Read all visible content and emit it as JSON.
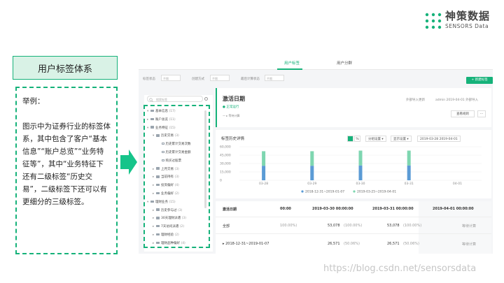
{
  "brand": {
    "name_cn": "神策数据",
    "name_en": "SENSORS Data",
    "accent": "#16b27a"
  },
  "left": {
    "title": "用户标签体系",
    "example_label": "举例：",
    "description": "图示中为证券行业的标签体系，其中包含了客户“基本信息”“账户总览”“业务特征等”，其中“业务特征下还有二级标签“历史交易”，二级标签下还可以有更细分的三级标签。"
  },
  "app": {
    "tabs": [
      "用户标签",
      "用户分群"
    ],
    "active_tab": "用户标签",
    "filters": [
      {
        "label": "标签状态",
        "value": "不限"
      },
      {
        "label": "创建方式",
        "value": "不限"
      },
      {
        "label": "最后计算状态",
        "value": "不限"
      }
    ],
    "add_button": "+ 新建标签",
    "tree": {
      "search_placeholder": "搜索标签",
      "items": [
        {
          "level": 0,
          "caret": "▾",
          "icon": "folder-icon",
          "label": "基本信息",
          "count": "(17)"
        },
        {
          "level": 0,
          "caret": "▸",
          "icon": "folder-icon",
          "label": "账户总览",
          "count": "(11)"
        },
        {
          "level": 0,
          "caret": "▾",
          "icon": "folder-icon",
          "label": "业务特征",
          "count": "(15)"
        },
        {
          "level": 1,
          "caret": "▾",
          "icon": "folder-icon",
          "label": "历史交易",
          "count": "(3)"
        },
        {
          "level": 2,
          "caret": "",
          "icon": "tag-icon",
          "label": "历史累计交易次数",
          "count": ""
        },
        {
          "level": 2,
          "caret": "",
          "icon": "tag-icon",
          "label": "历史累计交易金额",
          "count": ""
        },
        {
          "level": 2,
          "caret": "",
          "icon": "tag-icon",
          "label": "购买过股票",
          "count": ""
        },
        {
          "level": 1,
          "caret": "▸",
          "icon": "folder-icon",
          "label": "上月交易",
          "count": "(3)"
        },
        {
          "level": 1,
          "caret": "▸",
          "icon": "folder-icon",
          "label": "当前持有",
          "count": "(3)"
        },
        {
          "level": 1,
          "caret": "▸",
          "icon": "folder-icon",
          "label": "投资偏好",
          "count": "(4)"
        },
        {
          "level": 1,
          "caret": "▸",
          "icon": "folder-icon",
          "label": "业务偏好",
          "count": "(2)"
        },
        {
          "level": 0,
          "caret": "▾",
          "icon": "folder-icon",
          "label": "理财业务",
          "count": "(15)"
        },
        {
          "level": 1,
          "caret": "▸",
          "icon": "folder-icon",
          "label": "历史参与过",
          "count": "(3)"
        },
        {
          "level": 1,
          "caret": "▸",
          "icon": "folder-icon",
          "label": "30天理财派遣",
          "count": "(3)"
        },
        {
          "level": 1,
          "caret": "▸",
          "icon": "folder-icon",
          "label": "7天访问派遣",
          "count": "(2)"
        },
        {
          "level": 1,
          "caret": "▸",
          "icon": "folder-icon",
          "label": "理财经验",
          "count": "(2)"
        },
        {
          "level": 1,
          "caret": "▸",
          "icon": "folder-icon",
          "label": "理财品种偏好",
          "count": "(4)"
        }
      ]
    },
    "detail": {
      "title": "激活日期",
      "status": "● 正常运行",
      "sub": "— ▸ 等待计算",
      "meta_1": "外部导入更新",
      "meta_2": "admin 2019-04-01 外部导入",
      "view_rule": "查看规则",
      "more": "···"
    },
    "chart_panel": {
      "title": "标签历史详情",
      "toggle_1": "",
      "toggle_2": "%",
      "group_setting": "分组设置 ▾",
      "display_setting": "显示设置 ▾",
      "date_range": "2019-03-28 2019-04-01"
    },
    "table": {
      "headers": [
        "激活日期",
        "00:00",
        "2019-03-30 00:00:00",
        "2019-03-31 00:00:00",
        "2019-04-01 00:00:00"
      ],
      "rows": [
        {
          "name": "全部",
          "c1": "100.00%)",
          "c2": "53,078",
          "c2p": "(100.00%)",
          "c3": "53,078",
          "c3p": "(100.00%)",
          "c4": "等待计算"
        },
        {
          "name": "▸ 2018-12-31~2019-01-07",
          "c1": "",
          "c2": "26,571",
          "c2p": "(50.06%)",
          "c3": "26,571",
          "c3p": "(50.06%)",
          "c4": "等待计算"
        }
      ]
    }
  },
  "chart_data": {
    "type": "bar",
    "categories": [
      "03-28",
      "03-29",
      "03-30",
      "03-31",
      "04-01"
    ],
    "series": [
      {
        "name": "2018-12-31~2019-01-07",
        "color": "#5b9bd5",
        "values": [
          26000,
          26000,
          26571,
          26571,
          0
        ]
      },
      {
        "name": "2019-03-25~2019-04-01",
        "color": "#7ed6b0",
        "values": [
          26000,
          26000,
          26507,
          26507,
          0
        ]
      }
    ],
    "ylim": [
      0,
      60000
    ],
    "yticks": [
      "60,000",
      "45,000",
      "30,000",
      "15,000",
      "0"
    ],
    "legend_position": "bottom",
    "stacked": true
  },
  "watermark": "https://blog.csdn.net/sensorsdata"
}
